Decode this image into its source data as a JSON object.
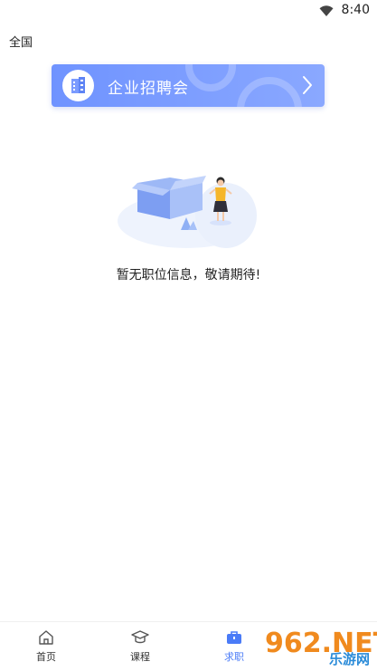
{
  "status_bar": {
    "time": "8:40"
  },
  "header": {
    "region": "全国"
  },
  "banner": {
    "title": "企业招聘会"
  },
  "empty_state": {
    "message": "暂无职位信息，敬请期待!"
  },
  "tabbar": {
    "items": [
      {
        "label": "首页",
        "icon": "home-icon",
        "active": false
      },
      {
        "label": "课程",
        "icon": "graduation-cap-icon",
        "active": false
      },
      {
        "label": "求职",
        "icon": "briefcase-icon",
        "active": true
      }
    ]
  },
  "watermark": {
    "brand": "962.NET",
    "brand_cn": "乐游网"
  },
  "colors": {
    "accent": "#4a7bf7",
    "banner_start": "#6f93ff",
    "banner_end": "#8aa8ff"
  }
}
